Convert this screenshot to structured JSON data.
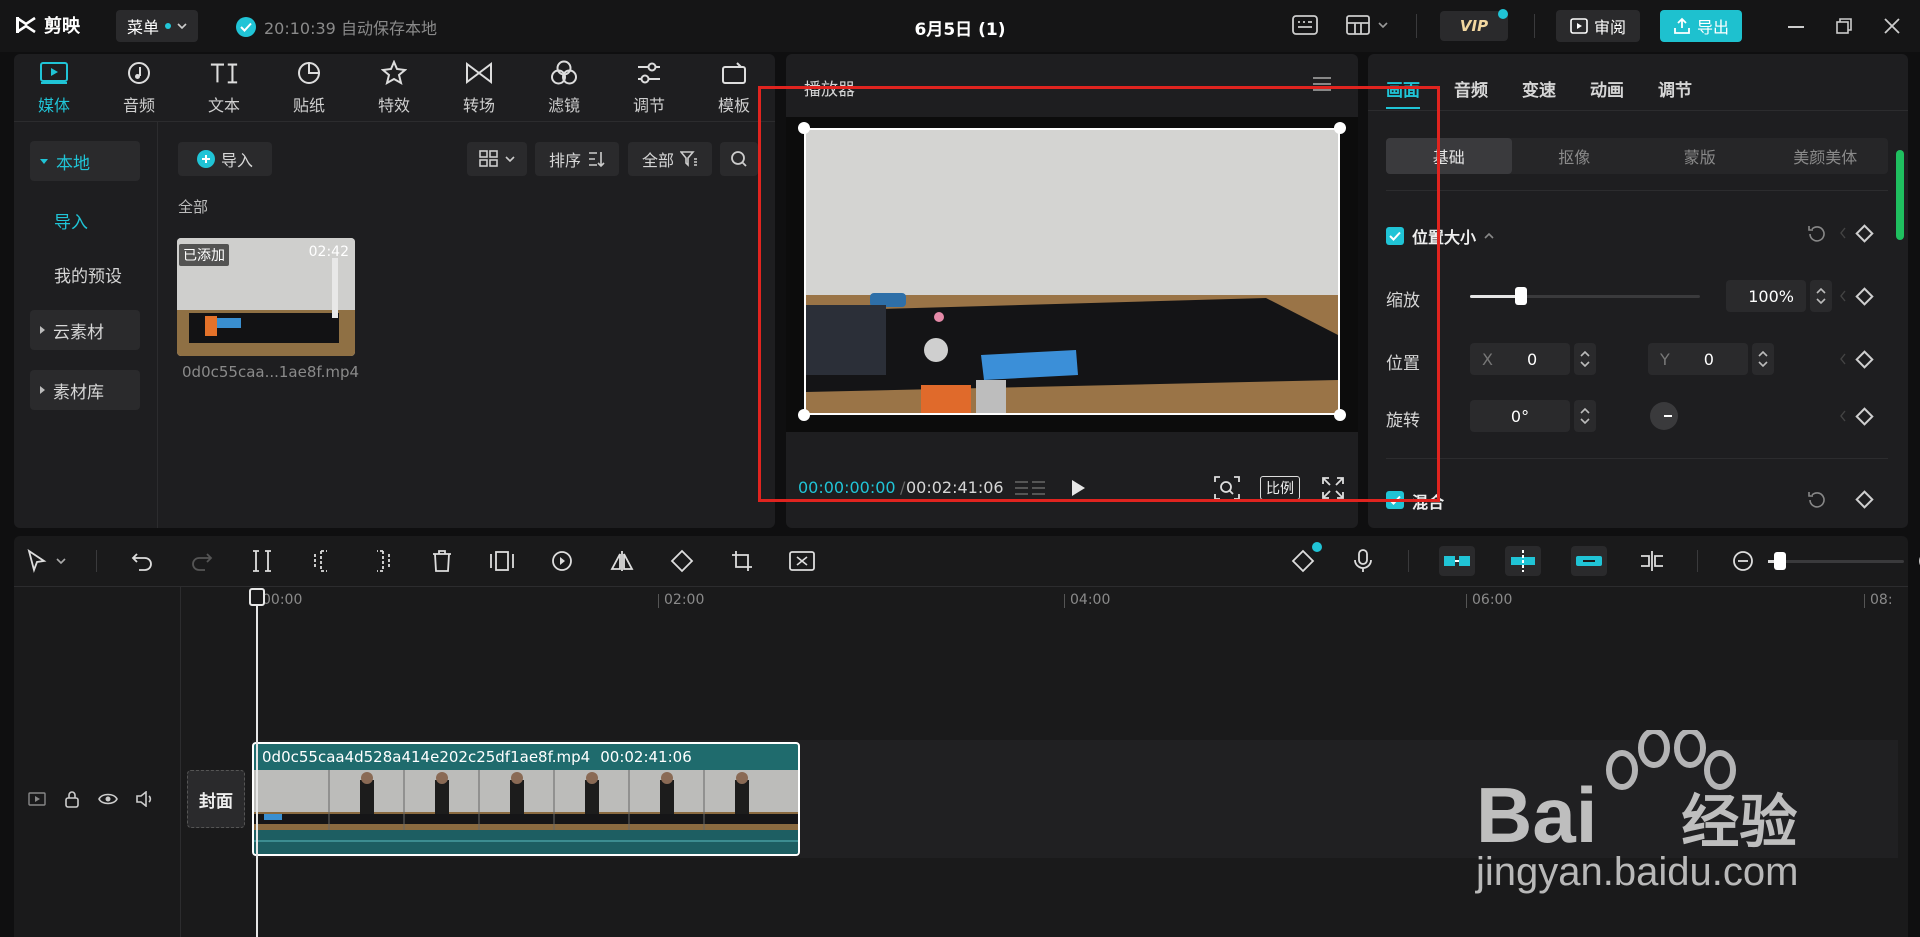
{
  "app": {
    "name": "剪映",
    "menu_label": "菜单",
    "autosave": "20:10:39 自动保存本地",
    "project_title": "6月5日 (1)",
    "vip_label": "VIP",
    "review_label": "审阅",
    "export_label": "导出"
  },
  "media": {
    "tabs": [
      {
        "label": "媒体",
        "icon": "media-icon"
      },
      {
        "label": "音频",
        "icon": "audio-icon"
      },
      {
        "label": "文本",
        "icon": "text-icon"
      },
      {
        "label": "贴纸",
        "icon": "sticker-icon"
      },
      {
        "label": "特效",
        "icon": "effects-icon"
      },
      {
        "label": "转场",
        "icon": "transition-icon"
      },
      {
        "label": "滤镜",
        "icon": "filter-icon"
      },
      {
        "label": "调节",
        "icon": "adjust-icon"
      },
      {
        "label": "模板",
        "icon": "template-icon"
      }
    ],
    "sidebar": {
      "local": "本地",
      "import": "导入",
      "presets": "我的预设",
      "cloud": "云素材",
      "library": "素材库"
    },
    "import_button": "导入",
    "sort_label": "排序",
    "filter_label": "全部",
    "section_label": "全部",
    "clip": {
      "badge": "已添加",
      "duration": "02:42",
      "filename": "0d0c55caa...1ae8f.mp4"
    }
  },
  "player": {
    "title": "播放器",
    "current_time": "00:00:00:00",
    "total_time": "00:02:41:06",
    "ratio_label": "比例"
  },
  "props": {
    "tabs": [
      "画面",
      "音频",
      "变速",
      "动画",
      "调节"
    ],
    "subtabs": [
      "基础",
      "抠像",
      "蒙版",
      "美颜美体"
    ],
    "section_position": "位置大小",
    "scale_label": "缩放",
    "scale_value": "100%",
    "scale_fraction": 0.22,
    "position_label": "位置",
    "x_label": "X",
    "x_value": "0",
    "y_label": "Y",
    "y_value": "0",
    "rotate_label": "旋转",
    "rotate_value": "0°",
    "section_blend": "混合"
  },
  "timeline": {
    "ruler": [
      "00:00",
      "02:00",
      "04:00",
      "06:00",
      "08:"
    ],
    "cover_label": "封面",
    "clip_name": "0d0c55caa4d528a414e202c25df1ae8f.mp4",
    "clip_duration": "00:02:41:06"
  },
  "watermark": {
    "brand": "Bai",
    "suffix": "经验",
    "url": "jingyan.baidu.com"
  },
  "colors": {
    "accent": "#20c4d6",
    "highlight_box": "#e0241f",
    "clip": "#1f6b6d"
  }
}
